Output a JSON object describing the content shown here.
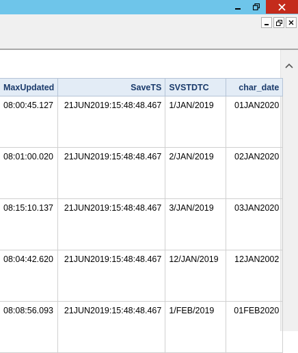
{
  "window": {
    "minimize_icon": "minimize-icon",
    "maximize_icon": "maximize-icon",
    "close_icon": "close-icon",
    "close_color": "#c42b1c",
    "titlebar_color": "#6ec5ea"
  },
  "table": {
    "header_color": "#e3ecf6",
    "header_text_color": "#1a3a6b",
    "columns": [
      "MaxUpdated",
      "SaveTS",
      "SVSTDTC",
      "char_date"
    ],
    "rows": [
      {
        "maxupdated": "08:00:45.127",
        "savets": "21JUN2019:15:48:48.467",
        "svstdtc": "1/JAN/2019",
        "char_date": "01JAN2020"
      },
      {
        "maxupdated": "08:01:00.020",
        "savets": "21JUN2019:15:48:48.467",
        "svstdtc": "2/JAN/2019",
        "char_date": "02JAN2020"
      },
      {
        "maxupdated": "08:15:10.137",
        "savets": "21JUN2019:15:48:48.467",
        "svstdtc": "3/JAN/2019",
        "char_date": "03JAN2020"
      },
      {
        "maxupdated": "08:04:42.620",
        "savets": "21JUN2019:15:48:48.467",
        "svstdtc": "12/JAN/2019",
        "char_date": "12JAN2002"
      },
      {
        "maxupdated": "08:08:56.093",
        "savets": "21JUN2019:15:48:48.467",
        "svstdtc": "1/FEB/2019",
        "char_date": "01FEB2020"
      }
    ]
  }
}
